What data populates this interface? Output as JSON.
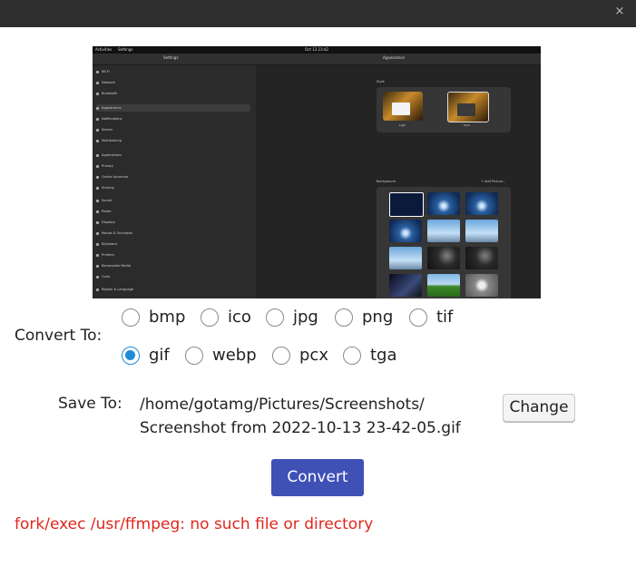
{
  "window": {
    "close_glyph": "×"
  },
  "preview": {
    "topbar_left_1": "Activities",
    "topbar_left_2": "Settings",
    "topbar_center": "Oct 13 23:42",
    "sidebar_title": "Settings",
    "main_title": "Appearance",
    "style_label": "Style",
    "style_light": "Light",
    "style_dark": "Dark",
    "background_label": "Background",
    "add_picture": "+ Add Picture...",
    "sidebar_items": [
      "Wi-Fi",
      "Network",
      "Bluetooth",
      "Appearance",
      "Notifications",
      "Search",
      "Multitasking",
      "Applications",
      "Privacy",
      "Online Accounts",
      "Sharing",
      "Sound",
      "Power",
      "Displays",
      "Mouse & Touchpad",
      "Keyboard",
      "Printers",
      "Removable Media",
      "Color",
      "Region & Language",
      "Accessibility"
    ]
  },
  "convert": {
    "label": "Convert To:",
    "options_row1": [
      "bmp",
      "ico",
      "jpg",
      "png",
      "tif"
    ],
    "options_row2": [
      "gif",
      "webp",
      "pcx",
      "tga"
    ],
    "selected": "gif"
  },
  "save": {
    "label": "Save To:",
    "path_line1": "/home/gotamg/Pictures/Screenshots/",
    "path_line2": "Screenshot from 2022-10-13 23-42-05.gif",
    "change_label": "Change"
  },
  "actions": {
    "convert_label": "Convert"
  },
  "status": {
    "error": "fork/exec /usr/ffmpeg: no such file or directory",
    "error_color": "#e0261c"
  },
  "colors": {
    "accent": "#3f51b5",
    "radio_selected": "#1f8ad8",
    "titlebar": "#2f2f2f"
  }
}
